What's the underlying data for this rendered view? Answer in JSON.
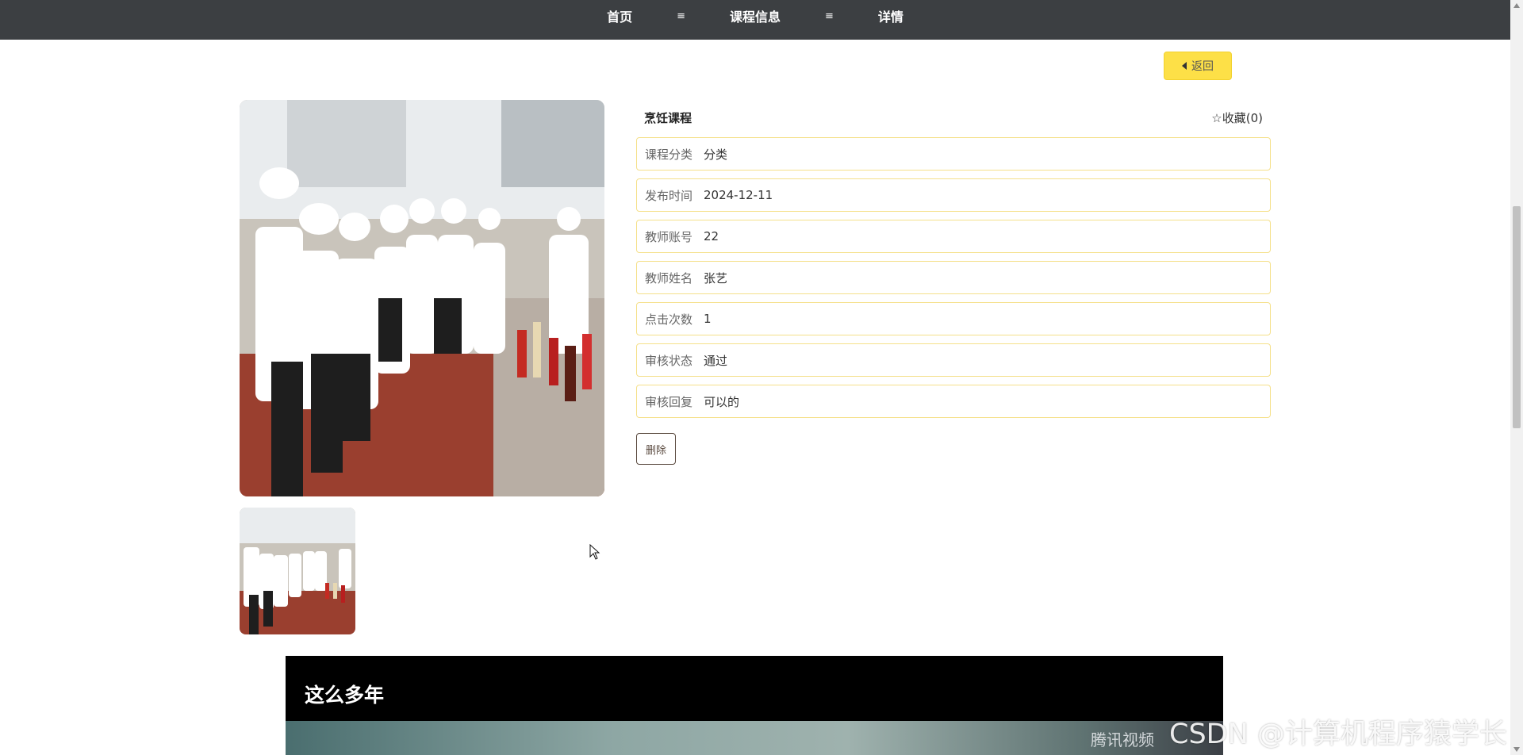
{
  "breadcrumb": {
    "home": "首页",
    "sep1": "≡",
    "courses": "课程信息",
    "sep2": "≡",
    "detail": "详情"
  },
  "back_button": {
    "label": "返回"
  },
  "course": {
    "title": "烹饪课程",
    "favorite_label": "☆收藏(0)",
    "fields": [
      {
        "label": "课程分类",
        "value": "分类"
      },
      {
        "label": "发布时间",
        "value": "2024-12-11"
      },
      {
        "label": "教师账号",
        "value": "22"
      },
      {
        "label": "教师姓名",
        "value": "张艺"
      },
      {
        "label": "点击次数",
        "value": "1"
      },
      {
        "label": "审核状态",
        "value": "通过"
      },
      {
        "label": "审核回复",
        "value": "可以的"
      }
    ]
  },
  "delete_button": {
    "label": "删除"
  },
  "video": {
    "title": "这么多年",
    "logo_text": "腾讯视频"
  },
  "watermark": "CSDN @计算机程序猿学长"
}
